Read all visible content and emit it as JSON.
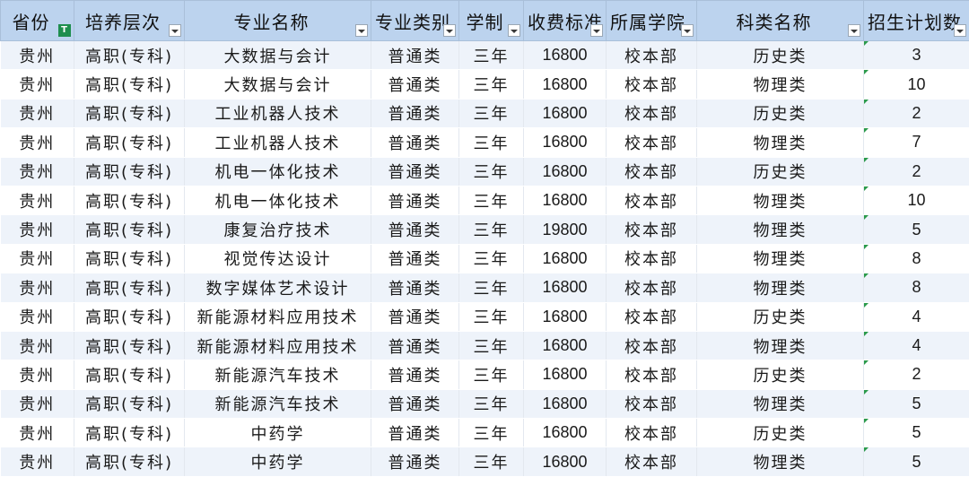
{
  "headers": [
    "省份",
    "培养层次",
    "专业名称",
    "专业类别",
    "学制",
    "收费标准",
    "所属学院",
    "科类名称",
    "招生计划数"
  ],
  "active_filter_column": 0,
  "rows": [
    [
      "贵州",
      "高职(专科)",
      "大数据与会计",
      "普通类",
      "三年",
      "16800",
      "校本部",
      "历史类",
      "3"
    ],
    [
      "贵州",
      "高职(专科)",
      "大数据与会计",
      "普通类",
      "三年",
      "16800",
      "校本部",
      "物理类",
      "10"
    ],
    [
      "贵州",
      "高职(专科)",
      "工业机器人技术",
      "普通类",
      "三年",
      "16800",
      "校本部",
      "历史类",
      "2"
    ],
    [
      "贵州",
      "高职(专科)",
      "工业机器人技术",
      "普通类",
      "三年",
      "16800",
      "校本部",
      "物理类",
      "7"
    ],
    [
      "贵州",
      "高职(专科)",
      "机电一体化技术",
      "普通类",
      "三年",
      "16800",
      "校本部",
      "历史类",
      "2"
    ],
    [
      "贵州",
      "高职(专科)",
      "机电一体化技术",
      "普通类",
      "三年",
      "16800",
      "校本部",
      "物理类",
      "10"
    ],
    [
      "贵州",
      "高职(专科)",
      "康复治疗技术",
      "普通类",
      "三年",
      "19800",
      "校本部",
      "物理类",
      "5"
    ],
    [
      "贵州",
      "高职(专科)",
      "视觉传达设计",
      "普通类",
      "三年",
      "16800",
      "校本部",
      "物理类",
      "8"
    ],
    [
      "贵州",
      "高职(专科)",
      "数字媒体艺术设计",
      "普通类",
      "三年",
      "16800",
      "校本部",
      "物理类",
      "8"
    ],
    [
      "贵州",
      "高职(专科)",
      "新能源材料应用技术",
      "普通类",
      "三年",
      "16800",
      "校本部",
      "历史类",
      "4"
    ],
    [
      "贵州",
      "高职(专科)",
      "新能源材料应用技术",
      "普通类",
      "三年",
      "16800",
      "校本部",
      "物理类",
      "4"
    ],
    [
      "贵州",
      "高职(专科)",
      "新能源汽车技术",
      "普通类",
      "三年",
      "16800",
      "校本部",
      "历史类",
      "2"
    ],
    [
      "贵州",
      "高职(专科)",
      "新能源汽车技术",
      "普通类",
      "三年",
      "16800",
      "校本部",
      "物理类",
      "5"
    ],
    [
      "贵州",
      "高职(专科)",
      "中药学",
      "普通类",
      "三年",
      "16800",
      "校本部",
      "历史类",
      "5"
    ],
    [
      "贵州",
      "高职(专科)",
      "中药学",
      "普通类",
      "三年",
      "16800",
      "校本部",
      "物理类",
      "5"
    ]
  ],
  "colors": {
    "header_bg": "#bcd3ee",
    "row_alt_bg": "#eef3fa",
    "filter_active": "#1e8e4e",
    "error_marker": "#2a9a4a"
  }
}
